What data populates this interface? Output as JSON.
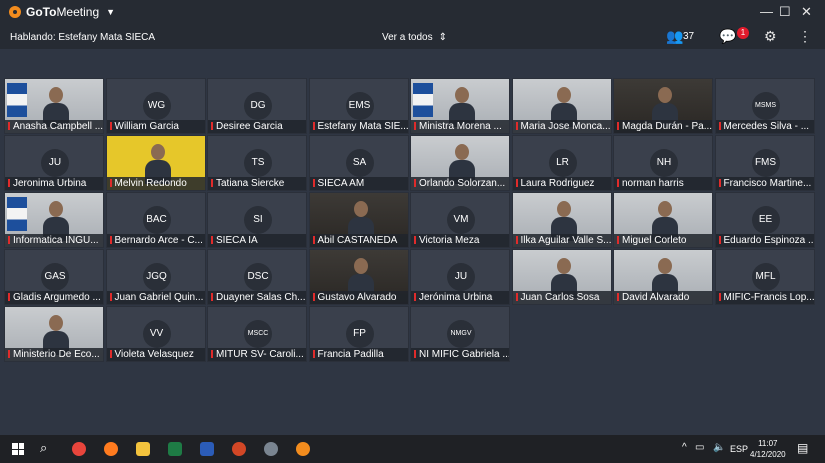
{
  "app": {
    "title_bold": "GoTo",
    "title_regular": "Meeting"
  },
  "toolbar": {
    "speaking": "Hablando: Estefany Mata SIECA",
    "view_all": "Ver a todos",
    "participant_count": "37",
    "chat_badge": "1"
  },
  "tiles": [
    {
      "name": "Anasha Campbell ...",
      "type": "video",
      "style": "flag"
    },
    {
      "name": "William Garcia",
      "type": "avatar",
      "initials": "WG"
    },
    {
      "name": "Desiree Garcia",
      "type": "avatar",
      "initials": "DG"
    },
    {
      "name": "Estefany Mata SIE...",
      "type": "avatar",
      "initials": "EMS"
    },
    {
      "name": "Ministra Morena ...",
      "type": "video",
      "style": "flag"
    },
    {
      "name": "Maria Jose Monca...",
      "type": "video",
      "style": ""
    },
    {
      "name": "Magda Durán - Pa...",
      "type": "video",
      "style": "dark"
    },
    {
      "name": "Mercedes Silva - ...",
      "type": "avatar",
      "initials": "MSMS",
      "small": true
    },
    {
      "name": "Jeronima Urbina",
      "type": "avatar",
      "initials": "JU"
    },
    {
      "name": "Melvin Redondo",
      "type": "video",
      "style": "yellow"
    },
    {
      "name": "Tatiana Siercke",
      "type": "avatar",
      "initials": "TS"
    },
    {
      "name": "SIECA AM",
      "type": "avatar",
      "initials": "SA"
    },
    {
      "name": "Orlando Solorzan...",
      "type": "video",
      "style": ""
    },
    {
      "name": "Laura Rodriguez",
      "type": "avatar",
      "initials": "LR"
    },
    {
      "name": "norman harris",
      "type": "avatar",
      "initials": "NH"
    },
    {
      "name": "Francisco Martine...",
      "type": "avatar",
      "initials": "FMS"
    },
    {
      "name": "Informatica INGU...",
      "type": "video",
      "style": "flag"
    },
    {
      "name": "Bernardo Arce - C...",
      "type": "avatar",
      "initials": "BAC"
    },
    {
      "name": "SIECA IA",
      "type": "avatar",
      "initials": "SI"
    },
    {
      "name": "Abil CASTANEDA",
      "type": "video",
      "style": "dark"
    },
    {
      "name": "Victoria Meza",
      "type": "avatar",
      "initials": "VM"
    },
    {
      "name": "Ilka Aguilar Valle S...",
      "type": "video",
      "style": ""
    },
    {
      "name": "Miguel Corleto",
      "type": "video",
      "style": ""
    },
    {
      "name": "Eduardo Espinoza ...",
      "type": "avatar",
      "initials": "EE"
    },
    {
      "name": "Gladis Argumedo ...",
      "type": "avatar",
      "initials": "GAS"
    },
    {
      "name": "Juan Gabriel Quin...",
      "type": "avatar",
      "initials": "JGQ"
    },
    {
      "name": "Duayner Salas Ch...",
      "type": "avatar",
      "initials": "DSC"
    },
    {
      "name": "Gustavo Alvarado",
      "type": "video",
      "style": "dark"
    },
    {
      "name": "Jerónima Urbina",
      "type": "avatar",
      "initials": "JU"
    },
    {
      "name": "Juan Carlos Sosa",
      "type": "video",
      "style": ""
    },
    {
      "name": "David Alvarado",
      "type": "video",
      "style": ""
    },
    {
      "name": "MIFIC-Francis Lop...",
      "type": "avatar",
      "initials": "MFL"
    },
    {
      "name": "Ministerio De Eco...",
      "type": "video",
      "style": ""
    },
    {
      "name": "Violeta Velasquez",
      "type": "avatar",
      "initials": "VV"
    },
    {
      "name": "MITUR SV- Caroli...",
      "type": "avatar",
      "initials": "MSCC",
      "small": true
    },
    {
      "name": "Francia Padilla",
      "type": "avatar",
      "initials": "FP"
    },
    {
      "name": "NI MIFIC Gabriela ...",
      "type": "avatar",
      "initials": "NMGV",
      "small": true
    }
  ],
  "tray": {
    "language": "ESP",
    "time": "11:07",
    "date": "4/12/2020"
  },
  "colors": {
    "accent": "#f28c1e",
    "badge": "#e21b2c",
    "background": "#2f3643"
  }
}
